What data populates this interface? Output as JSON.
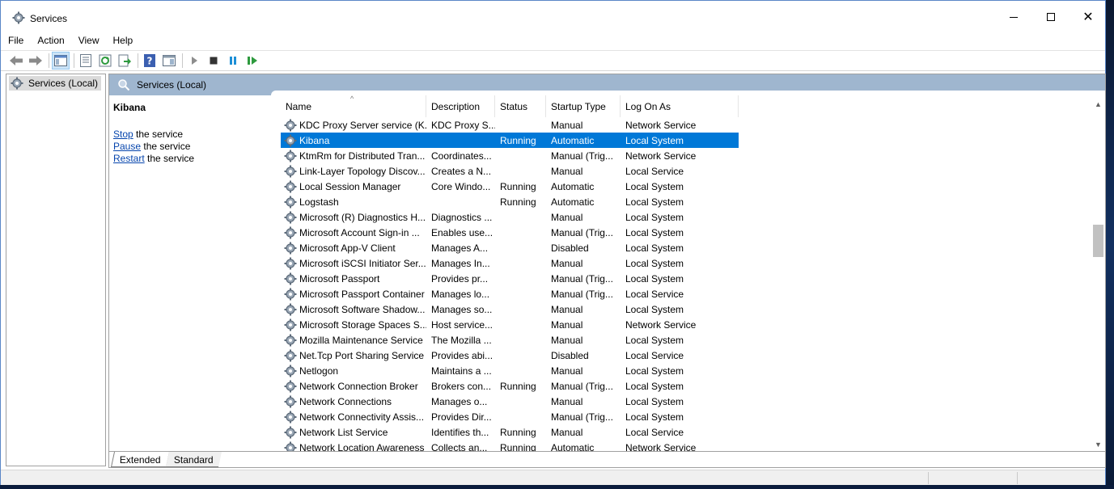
{
  "window": {
    "title": "Services",
    "controls": {
      "minimize": "",
      "maximize": "",
      "close": "✕"
    }
  },
  "menu": [
    "File",
    "Action",
    "View",
    "Help"
  ],
  "toolbar": {
    "buttons": [
      "back-arrow-icon",
      "forward-arrow-icon",
      "show-hide-tree-icon",
      "properties-icon",
      "refresh-icon",
      "export-list-icon",
      "help-icon",
      "show-hide-action-pane-icon",
      "start-service-icon",
      "stop-service-icon",
      "pause-service-icon",
      "resume-service-icon"
    ]
  },
  "tree": {
    "root_label": "Services (Local)"
  },
  "pane": {
    "header": "Services (Local)",
    "detail": {
      "title": "Kibana",
      "actions": [
        {
          "link": "Stop",
          "rest": " the service"
        },
        {
          "link": "Pause",
          "rest": " the service"
        },
        {
          "link": "Restart",
          "rest": " the service"
        }
      ]
    },
    "columns": {
      "name": "Name",
      "description": "Description",
      "status": "Status",
      "startup": "Startup Type",
      "logon": "Log On As"
    },
    "sort_indicator": "^",
    "rows": [
      {
        "name": "KDC Proxy Server service (K...",
        "description": "KDC Proxy S...",
        "status": "",
        "startup": "Manual",
        "logon": "Network Service"
      },
      {
        "name": "Kibana",
        "description": "",
        "status": "Running",
        "startup": "Automatic",
        "logon": "Local System",
        "selected": true
      },
      {
        "name": "KtmRm for Distributed Tran...",
        "description": "Coordinates...",
        "status": "",
        "startup": "Manual (Trig...",
        "logon": "Network Service"
      },
      {
        "name": "Link-Layer Topology Discov...",
        "description": "Creates a N...",
        "status": "",
        "startup": "Manual",
        "logon": "Local Service"
      },
      {
        "name": "Local Session Manager",
        "description": "Core Windo...",
        "status": "Running",
        "startup": "Automatic",
        "logon": "Local System"
      },
      {
        "name": "Logstash",
        "description": "",
        "status": "Running",
        "startup": "Automatic",
        "logon": "Local System"
      },
      {
        "name": "Microsoft (R) Diagnostics H...",
        "description": "Diagnostics ...",
        "status": "",
        "startup": "Manual",
        "logon": "Local System"
      },
      {
        "name": "Microsoft Account Sign-in ...",
        "description": "Enables use...",
        "status": "",
        "startup": "Manual (Trig...",
        "logon": "Local System"
      },
      {
        "name": "Microsoft App-V Client",
        "description": "Manages A...",
        "status": "",
        "startup": "Disabled",
        "logon": "Local System"
      },
      {
        "name": "Microsoft iSCSI Initiator Ser...",
        "description": "Manages In...",
        "status": "",
        "startup": "Manual",
        "logon": "Local System"
      },
      {
        "name": "Microsoft Passport",
        "description": "Provides pr...",
        "status": "",
        "startup": "Manual (Trig...",
        "logon": "Local System"
      },
      {
        "name": "Microsoft Passport Container",
        "description": "Manages lo...",
        "status": "",
        "startup": "Manual (Trig...",
        "logon": "Local Service"
      },
      {
        "name": "Microsoft Software Shadow...",
        "description": "Manages so...",
        "status": "",
        "startup": "Manual",
        "logon": "Local System"
      },
      {
        "name": "Microsoft Storage Spaces S...",
        "description": "Host service...",
        "status": "",
        "startup": "Manual",
        "logon": "Network Service"
      },
      {
        "name": "Mozilla Maintenance Service",
        "description": "The Mozilla ...",
        "status": "",
        "startup": "Manual",
        "logon": "Local System"
      },
      {
        "name": "Net.Tcp Port Sharing Service",
        "description": "Provides abi...",
        "status": "",
        "startup": "Disabled",
        "logon": "Local Service"
      },
      {
        "name": "Netlogon",
        "description": "Maintains a ...",
        "status": "",
        "startup": "Manual",
        "logon": "Local System"
      },
      {
        "name": "Network Connection Broker",
        "description": "Brokers con...",
        "status": "Running",
        "startup": "Manual (Trig...",
        "logon": "Local System"
      },
      {
        "name": "Network Connections",
        "description": "Manages o...",
        "status": "",
        "startup": "Manual",
        "logon": "Local System"
      },
      {
        "name": "Network Connectivity Assis...",
        "description": "Provides Dir...",
        "status": "",
        "startup": "Manual (Trig...",
        "logon": "Local System"
      },
      {
        "name": "Network List Service",
        "description": "Identifies th...",
        "status": "Running",
        "startup": "Manual",
        "logon": "Local Service"
      },
      {
        "name": "Network Location Awareness",
        "description": "Collects an...",
        "status": "Running",
        "startup": "Automatic",
        "logon": "Network Service"
      }
    ],
    "tabs": [
      "Extended",
      "Standard"
    ]
  },
  "colors": {
    "selection": "#0078d7",
    "header_band": "#9fb6cf",
    "link": "#0645ad"
  }
}
